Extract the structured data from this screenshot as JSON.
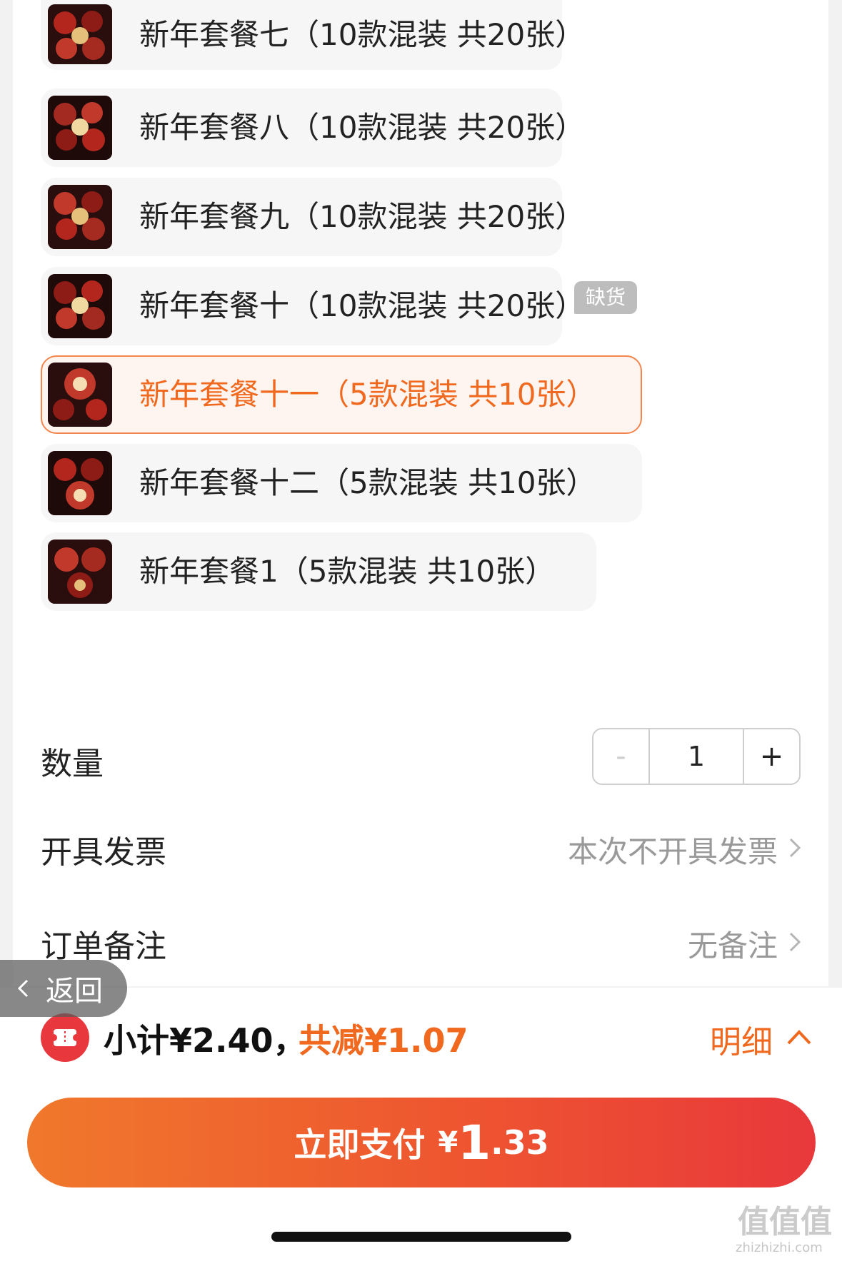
{
  "sku_options": [
    {
      "label": "新年套餐七（10款混装 共20张）",
      "selected": false,
      "out_of_stock": false
    },
    {
      "label": "新年套餐八（10款混装 共20张）",
      "selected": false,
      "out_of_stock": false
    },
    {
      "label": "新年套餐九（10款混装 共20张）",
      "selected": false,
      "out_of_stock": false
    },
    {
      "label": "新年套餐十（10款混装 共20张）",
      "selected": false,
      "out_of_stock": true
    },
    {
      "label": "新年套餐十一（5款混装 共10张）",
      "selected": true,
      "out_of_stock": false
    },
    {
      "label": "新年套餐十二（5款混装 共10张）",
      "selected": false,
      "out_of_stock": false
    },
    {
      "label": "新年套餐1（5款混装 共10张）",
      "selected": false,
      "out_of_stock": false
    }
  ],
  "out_of_stock_badge": "缺货",
  "quantity": {
    "label": "数量",
    "minus": "-",
    "value": "1",
    "plus": "+"
  },
  "invoice": {
    "label": "开具发票",
    "value": "本次不开具发票"
  },
  "remark": {
    "label": "订单备注",
    "value": "无备注"
  },
  "back": {
    "label": "返回"
  },
  "summary": {
    "subtotal": "小计¥2.40，",
    "discount": "共减¥1.07",
    "detail": "明细"
  },
  "pay": {
    "label": "立即支付",
    "currency": "¥",
    "amount_int": "1",
    "amount_dec": ".33"
  },
  "watermark": {
    "main": "值值值",
    "sub": "zhizhizhi.com"
  },
  "colors": {
    "accent": "#f0691f",
    "pay_start": "#f0782c",
    "pay_end": "#e8383b",
    "muted": "#999999"
  }
}
